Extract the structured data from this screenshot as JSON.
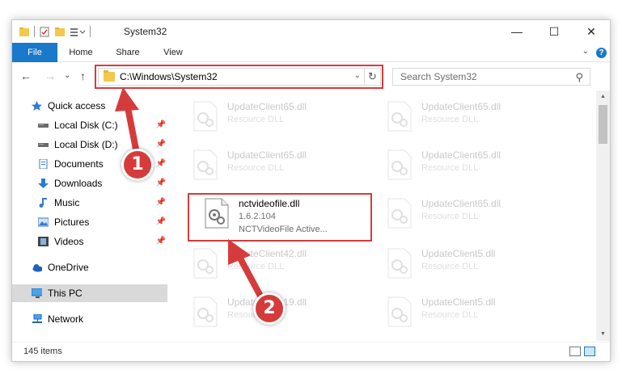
{
  "window": {
    "title": "System32",
    "controls": {
      "minimize": "—",
      "maximize": "☐",
      "close": "✕"
    }
  },
  "ribbon": {
    "tabs": [
      "File",
      "Home",
      "Share",
      "View"
    ],
    "help": "?",
    "expand": "⌄"
  },
  "nav": {
    "back": "←",
    "forward": "→",
    "recent": "⌄",
    "up": "↑",
    "address": "C:\\Windows\\System32",
    "address_dropdown": "⌄",
    "refresh": "↻",
    "search_placeholder": "Search System32",
    "search_icon": "⚲"
  },
  "sidebar": {
    "items": [
      {
        "label": "Quick access",
        "icon": "star-icon",
        "pinned": false
      },
      {
        "label": "Local Disk (C:)",
        "icon": "drive-icon",
        "pinned": true
      },
      {
        "label": "Local Disk (D:)",
        "icon": "drive-icon",
        "pinned": true
      },
      {
        "label": "Documents",
        "icon": "documents-icon",
        "pinned": true
      },
      {
        "label": "Downloads",
        "icon": "download-icon",
        "pinned": true
      },
      {
        "label": "Music",
        "icon": "music-icon",
        "pinned": true
      },
      {
        "label": "Pictures",
        "icon": "pictures-icon",
        "pinned": true
      },
      {
        "label": "Videos",
        "icon": "videos-icon",
        "pinned": true
      },
      {
        "label": "OneDrive",
        "icon": "cloud-icon",
        "pinned": false
      },
      {
        "label": "This PC",
        "icon": "computer-icon",
        "pinned": false
      },
      {
        "label": "Network",
        "icon": "network-icon",
        "pinned": false
      }
    ],
    "pin_glyph": "📌"
  },
  "files": [
    {
      "name": "UpdateClient65.dll",
      "type": "Resource DLL",
      "faded": true
    },
    {
      "name": "UpdateClient65.dll",
      "type": "Resource DLL",
      "faded": true
    },
    {
      "name": "UpdateClient65.dll",
      "type": "Resource DLL",
      "faded": true
    },
    {
      "name": "UpdateClient65.dll",
      "type": "Resource DLL",
      "faded": true
    },
    {
      "name": "nctvideofile.dll",
      "version": "1.6.2.104",
      "description": "NCTVideoFile Active...",
      "faded": false
    },
    {
      "name": "UpdateClient65.dll",
      "type": "Resource DLL",
      "faded": true
    },
    {
      "name": "UpdateClient42.dll",
      "type": "Resource DLL",
      "faded": true
    },
    {
      "name": "UpdateClient5.dll",
      "type": "Resource DLL",
      "faded": true
    },
    {
      "name": "UpdateClient19.dll",
      "type": "Resource DLL",
      "faded": true
    },
    {
      "name": "UpdateClient5.dll",
      "type": "Resource DLL",
      "faded": true
    }
  ],
  "status": {
    "count": "145 items"
  },
  "callouts": [
    "1",
    "2"
  ],
  "colors": {
    "accent": "#1979ca",
    "highlight": "#d63b3b"
  }
}
